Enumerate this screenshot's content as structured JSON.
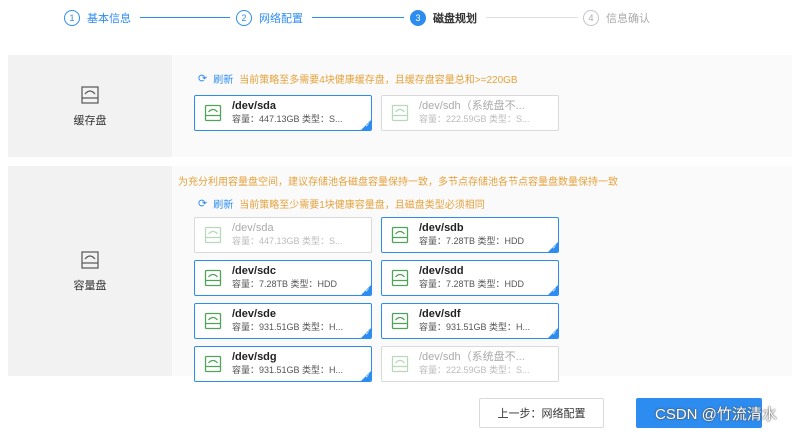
{
  "steps": [
    {
      "num": "1",
      "label": "基本信息",
      "state": "done"
    },
    {
      "num": "2",
      "label": "网络配置",
      "state": "done"
    },
    {
      "num": "3",
      "label": "磁盘规划",
      "state": "active"
    },
    {
      "num": "4",
      "label": "信息确认",
      "state": "todo"
    }
  ],
  "cache": {
    "label": "缓存盘",
    "refresh": "刷新",
    "rule": "当前策略至多需要4块健康缓存盘，且缓存盘容量总和>=220GB",
    "disks": [
      {
        "name": "/dev/sda",
        "info": "容量：447.13GB 类型：S...",
        "selected": true,
        "disabled": false
      },
      {
        "name": "/dev/sdh（系统盘不...",
        "info": "容量：222.59GB 类型：S...",
        "selected": false,
        "disabled": true
      }
    ]
  },
  "capacity": {
    "label": "容量盘",
    "advice": "为充分利用容量盘空间，建议存储池各磁盘容量保持一致，多节点存储池各节点容量盘数量保持一致",
    "refresh": "刷新",
    "rule": "当前策略至少需要1块健康容量盘，且磁盘类型必须相同",
    "disks": [
      {
        "name": "/dev/sda",
        "info": "容量：447.13GB 类型：S...",
        "selected": false,
        "disabled": true
      },
      {
        "name": "/dev/sdb",
        "info": "容量：7.28TB 类型：HDD",
        "selected": true,
        "disabled": false
      },
      {
        "name": "/dev/sdc",
        "info": "容量：7.28TB 类型：HDD",
        "selected": true,
        "disabled": false
      },
      {
        "name": "/dev/sdd",
        "info": "容量：7.28TB 类型：HDD",
        "selected": true,
        "disabled": false
      },
      {
        "name": "/dev/sde",
        "info": "容量：931.51GB 类型：H...",
        "selected": true,
        "disabled": false
      },
      {
        "name": "/dev/sdf",
        "info": "容量：931.51GB 类型：H...",
        "selected": true,
        "disabled": false
      },
      {
        "name": "/dev/sdg",
        "info": "容量：931.51GB 类型：H...",
        "selected": true,
        "disabled": false
      },
      {
        "name": "/dev/sdh（系统盘不...",
        "info": "容量：222.59GB 类型：S...",
        "selected": false,
        "disabled": true
      }
    ]
  },
  "footer": {
    "prev": "上一步：网络配置",
    "next": "",
    "watermark": "CSDN @竹流清水"
  },
  "colors": {
    "primary": "#2d8cf0",
    "warning": "#e6a23c",
    "disk_icon": "#52a35a"
  }
}
